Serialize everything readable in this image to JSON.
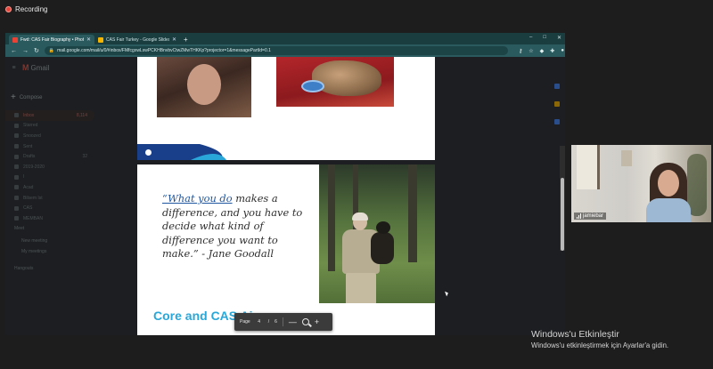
{
  "recording": {
    "label": "Recording"
  },
  "browser": {
    "tabs": [
      {
        "label": "Fwd: CAS Fair Biography • Photo",
        "active": true,
        "favicon_color": "#ea4335"
      },
      {
        "label": "CAS Fair Turkey - Google Slides",
        "active": false,
        "favicon_color": "#f4b400"
      }
    ],
    "new_tab": "+",
    "window_controls": [
      "–",
      "□",
      "✕"
    ],
    "address": "mail.google.com/mail/u/0/#inbox/FMfcgxwLswPCKHBnvbvCtwZMwTHKKp?projector=1&messagePartId=0.1"
  },
  "gmail": {
    "app_name": "Gmail",
    "compose_label": "Compose",
    "items": [
      {
        "label": "Inbox",
        "count": "8,114",
        "selected": true
      },
      {
        "label": "Starred",
        "count": ""
      },
      {
        "label": "Snoozed",
        "count": ""
      },
      {
        "label": "Sent",
        "count": ""
      },
      {
        "label": "Drafts",
        "count": "32"
      },
      {
        "label": "2019-2020",
        "count": ""
      },
      {
        "label": "I",
        "count": ""
      },
      {
        "label": "Acad",
        "count": ""
      },
      {
        "label": "Bilsem Ist",
        "count": ""
      },
      {
        "label": "CAS",
        "count": ""
      },
      {
        "label": "MEMBAN",
        "count": ""
      }
    ],
    "meet_heading": "Meet",
    "meet_items": [
      "New meeting",
      "My meetings"
    ],
    "hangouts_heading": "Hangouts"
  },
  "viewer": {
    "quote_highlight": "“What you do",
    "quote_rest": " makes a difference, and you have to decide what kind of difference you want to make.” - Jane Goodall",
    "next_slide_title": "Core and CAS Aims",
    "page_label": "Page",
    "page_current": "4",
    "page_sep": "/",
    "page_total": "6",
    "zoom_out": "—",
    "zoom_in": "+"
  },
  "video": {
    "participant_name": "jamiebar"
  },
  "watermark": {
    "title": "Windows'u Etkinleştir",
    "subtitle": "Windows'u etkinleştirmek için Ayarlar'a gidin."
  },
  "colors": {
    "accent_teal": "#2a5a5e",
    "quote_blue": "#1f56a0",
    "slide_title_blue": "#2aa7d9",
    "recording_red": "#e8453c"
  }
}
